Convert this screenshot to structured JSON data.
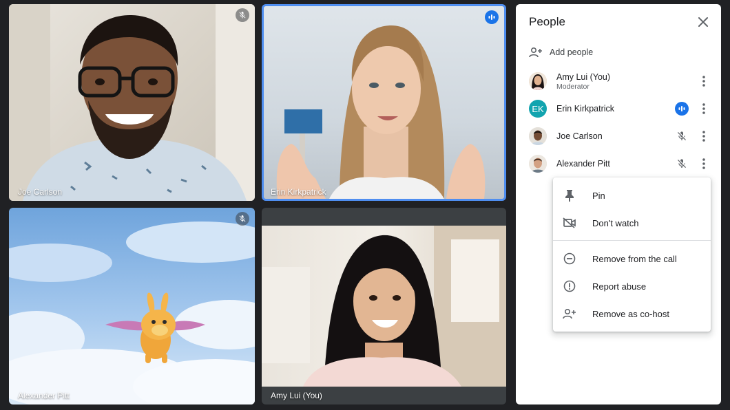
{
  "tiles": [
    {
      "name": "Joe Carlson",
      "state": "muted"
    },
    {
      "name": "Erin Kirkpatrick",
      "state": "speaking"
    },
    {
      "name": "Alexander Pitt",
      "state": "muted"
    },
    {
      "name": "Amy Lui (You)",
      "state": "none"
    }
  ],
  "panel": {
    "title": "People",
    "add_people": "Add people",
    "participants": [
      {
        "name": "Amy Lui (You)",
        "role": "Moderator",
        "avatar": "photo"
      },
      {
        "name": "Erin Kirkpatrick",
        "initials": "EK",
        "avatar_color": "#12a4af",
        "status": "speaking"
      },
      {
        "name": "Joe Carlson",
        "status": "muted"
      },
      {
        "name": "Alexander Pitt",
        "status": "muted"
      }
    ]
  },
  "menu": {
    "items": [
      {
        "label": "Pin",
        "icon": "pin-icon"
      },
      {
        "label": "Don't watch",
        "icon": "videocam-off-icon"
      },
      {
        "label": "Remove from the call",
        "icon": "remove-circle-icon"
      },
      {
        "label": "Report abuse",
        "icon": "report-icon"
      },
      {
        "label": "Remove as co-host",
        "icon": "person-add-icon"
      }
    ]
  },
  "colors": {
    "accent": "#1a73e8",
    "speaking_border": "#4f8ef0",
    "background": "#202124"
  }
}
